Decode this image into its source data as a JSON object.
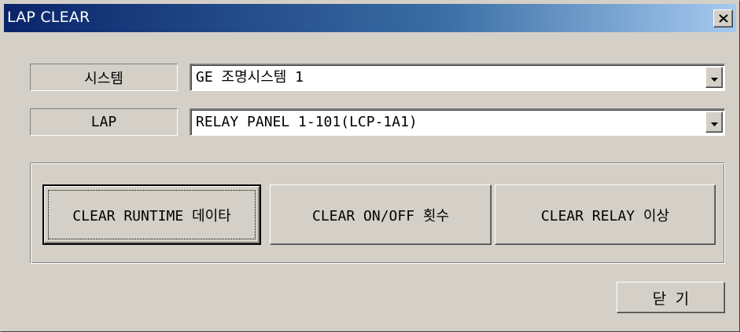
{
  "window": {
    "title": "LAP CLEAR"
  },
  "titlebar": {
    "close_icon": "close-icon"
  },
  "fields": {
    "system": {
      "label": "시스템",
      "value": "GE 조명시스템 1"
    },
    "lap": {
      "label": "LAP",
      "value": "RELAY PANEL 1-101(LCP-1A1)"
    }
  },
  "actions": {
    "clear_runtime": "CLEAR RUNTIME 데이타",
    "clear_onoff": "CLEAR ON/OFF 횟수",
    "clear_relay": "CLEAR RELAY 이상"
  },
  "footer": {
    "close_label": "닫 기"
  },
  "colors": {
    "title_start": "#0a246a",
    "title_end": "#a6caf0",
    "face": "#d4d0c8"
  }
}
